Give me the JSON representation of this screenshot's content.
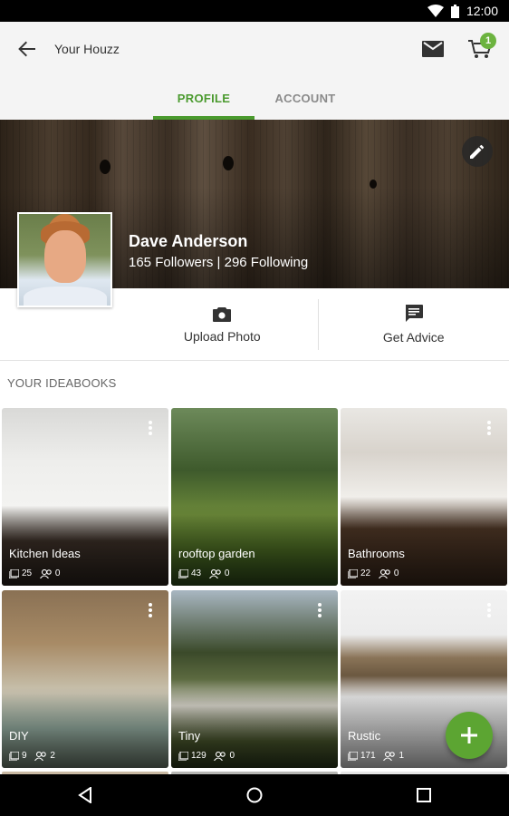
{
  "status": {
    "time": "12:00",
    "wifi_icon": "wifi-icon",
    "battery_icon": "battery-icon"
  },
  "header": {
    "title": "Your Houzz",
    "cart_count": "1"
  },
  "tabs": [
    {
      "label": "PROFILE",
      "active": true
    },
    {
      "label": "ACCOUNT",
      "active": false
    }
  ],
  "profile": {
    "name": "Dave Anderson",
    "stats": "165 Followers | 296 Following"
  },
  "actions": {
    "upload_label": "Upload Photo",
    "advice_label": "Get Advice"
  },
  "ideabooks_label": "YOUR IDEABOOKS",
  "ideabooks": [
    {
      "title": "Kitchen Ideas",
      "photos": "25",
      "collaborators": "0"
    },
    {
      "title": "rooftop garden",
      "photos": "43",
      "collaborators": "0"
    },
    {
      "title": "Bathrooms",
      "photos": "22",
      "collaborators": "0"
    },
    {
      "title": "DIY",
      "photos": "9",
      "collaborators": "2"
    },
    {
      "title": "Tiny",
      "photos": "129",
      "collaborators": "0"
    },
    {
      "title": "Rustic",
      "photos": "171",
      "collaborators": "1"
    }
  ],
  "colors": {
    "accent": "#4a9a2e",
    "fab": "#5ca532",
    "app_bar": "#f4f4f4"
  }
}
